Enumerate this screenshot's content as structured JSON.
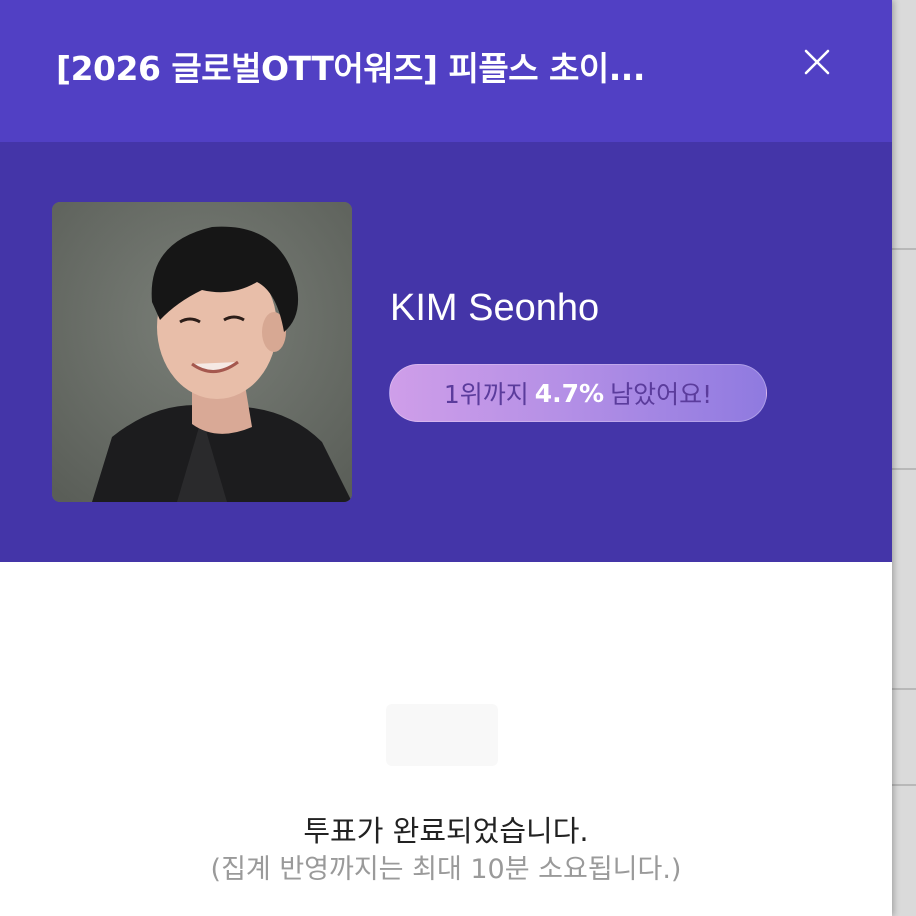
{
  "modal": {
    "title": "[2026 글로벌OTT어워즈] 피플스 초이...",
    "close_icon": "close-icon"
  },
  "candidate": {
    "name": "KIM Seonho",
    "photo_icon": "person-photo",
    "rank_gap": {
      "prefix": "1위까지",
      "percent": "4.7%",
      "suffix": "남았어요!"
    }
  },
  "result": {
    "message": "투표가 완료되었습니다.",
    "note": "(집계 반영까지는 최대 10분 소요됩니다.)"
  },
  "colors": {
    "header": "#5140c4",
    "hero": "#4435a8",
    "pill_start": "#cf9ee9",
    "pill_end": "#8f7ae0"
  }
}
